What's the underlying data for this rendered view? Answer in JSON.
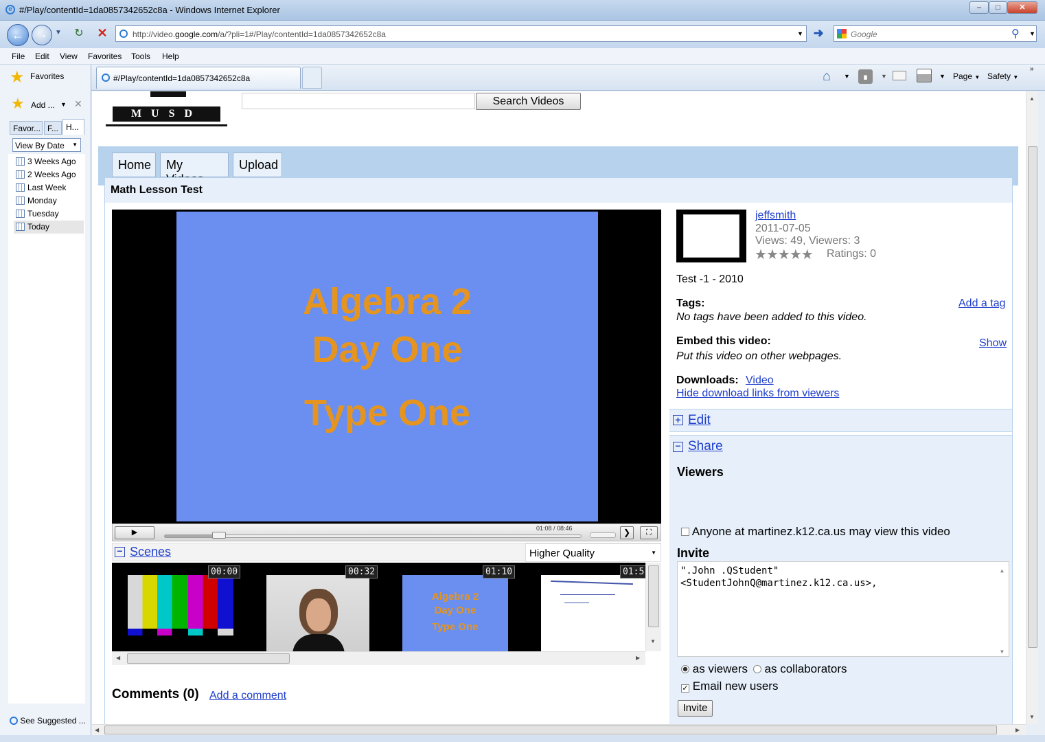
{
  "window": {
    "title": "#/Play/contentId=1da0857342652c8a - Windows Internet Explorer",
    "url_prefix": "http://video.",
    "url_domain": "google.com",
    "url_suffix": "/a/?pli=1#/Play/contentId=1da0857342652c8a",
    "search_placeholder": "Google"
  },
  "menu": [
    "File",
    "Edit",
    "View",
    "Favorites",
    "Tools",
    "Help"
  ],
  "favorites_bar": {
    "favorites_label": "Favorites",
    "tab_title": "#/Play/contentId=1da0857342652c8a",
    "page_label": "Page",
    "safety_label": "Safety"
  },
  "left_panel": {
    "add_label": "Add ...",
    "tabs": [
      "Favor...",
      "F...",
      "H..."
    ],
    "view_select": "View By Date",
    "history": [
      "3 Weeks Ago",
      "2 Weeks Ago",
      "Last Week",
      "Monday",
      "Tuesday",
      "Today"
    ],
    "see_suggested": "See Suggested ..."
  },
  "site": {
    "logo_text": "MUSD",
    "search_button": "Search Videos",
    "nav": [
      "Home",
      "My Videos",
      "Upload"
    ],
    "video_title": "Math Lesson Test"
  },
  "player": {
    "slide_lines": [
      "Algebra 2",
      "Day One",
      "Type One"
    ],
    "time": "01:08 / 08:46",
    "scenes_label": "Scenes",
    "quality": "Higher Quality",
    "scene_times": [
      "00:00",
      "00:32",
      "01:10",
      "01:5"
    ],
    "slide_color": "#6a8ff0",
    "text_color": "#e5951f",
    "progress_fraction": 0.13
  },
  "comments": {
    "label": "Comments (0)",
    "add_link": "Add a comment"
  },
  "info": {
    "owner": "jeffsmith",
    "date": "2011-07-05",
    "views": "Views: 49, Viewers: 3",
    "ratings": "Ratings: 0",
    "rating_stars": 5,
    "description": "Test -1 - 2010",
    "tags_label": "Tags:",
    "add_tag": "Add a tag",
    "no_tags": "No tags have been added to this video.",
    "embed_label": "Embed this video:",
    "show_link": "Show",
    "embed_desc": "Put this video on other webpages.",
    "downloads_label": "Downloads:",
    "download_video": "Video",
    "hide_download": "Hide download links from viewers",
    "edit_label": "Edit",
    "share_label": "Share",
    "viewers_heading": "Viewers",
    "anyone_label": "Anyone at martinez.k12.ca.us may view this video",
    "invite_heading": "Invite",
    "invite_text_line1": "\".John .QStudent\"",
    "invite_text_line2": "<StudentJohnQ@martinez.k12.ca.us>,",
    "as_viewers": "as viewers",
    "as_collaborators": "as collaborators",
    "email_new_users": "Email new users",
    "invite_button": "Invite"
  }
}
